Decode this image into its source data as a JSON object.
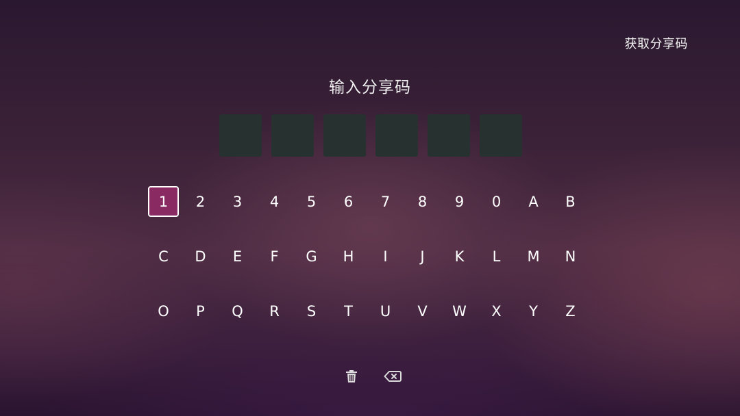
{
  "header": {
    "get_code_label": "获取分享码"
  },
  "title": "输入分享码",
  "code": {
    "slots": [
      "",
      "",
      "",
      "",
      "",
      ""
    ]
  },
  "keyboard": {
    "rows": [
      [
        "1",
        "2",
        "3",
        "4",
        "5",
        "6",
        "7",
        "8",
        "9",
        "0",
        "A",
        "B"
      ],
      [
        "C",
        "D",
        "E",
        "F",
        "G",
        "H",
        "I",
        "J",
        "K",
        "L",
        "M",
        "N"
      ],
      [
        "O",
        "P",
        "Q",
        "R",
        "S",
        "T",
        "U",
        "V",
        "W",
        "X",
        "Y",
        "Z"
      ]
    ],
    "focused_key": "1"
  },
  "actions": {
    "clear_icon": "trash-icon",
    "backspace_icon": "backspace-icon"
  },
  "colors": {
    "focus_fill": "#8a2a62",
    "code_box": "#263130",
    "text": "#ffffff"
  }
}
